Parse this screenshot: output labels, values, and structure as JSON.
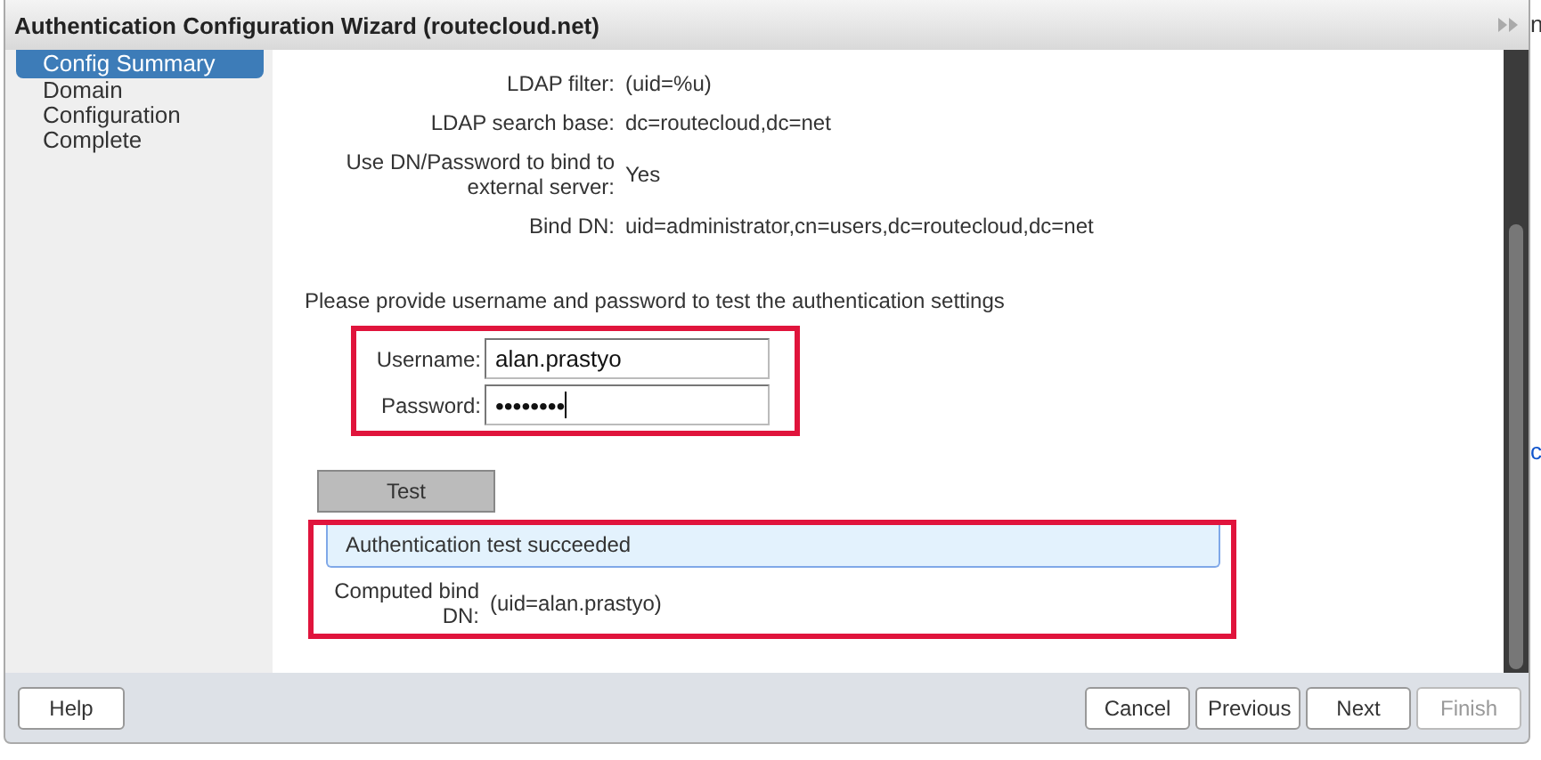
{
  "window": {
    "title": "Authentication Configuration Wizard (routecloud.net)"
  },
  "background_fragments": [
    "n",
    "c"
  ],
  "steps": [
    {
      "label": "Config Summary",
      "selected": true
    },
    {
      "label": "Domain Configuration",
      "selected": false
    },
    {
      "label": "Complete",
      "selected": false
    }
  ],
  "summary": [
    {
      "label": "LDAP filter:",
      "value": "(uid=%u)"
    },
    {
      "label": "LDAP search base:",
      "value": "dc=routecloud,dc=net"
    },
    {
      "label": "Use DN/Password to bind to external server:",
      "value": "Yes"
    },
    {
      "label": "Bind DN:",
      "value": "uid=administrator,cn=users,dc=routecloud,dc=net"
    }
  ],
  "test": {
    "instruction": "Please provide username and password to test the authentication settings",
    "username": {
      "label": "Username:",
      "value": "alan.prastyo"
    },
    "password": {
      "label": "Password:",
      "value": "••••••••"
    },
    "button": "Test",
    "result": {
      "message": "Authentication test succeeded",
      "label": "Computed bind DN:",
      "value": "(uid=alan.prastyo)"
    }
  },
  "footer": {
    "left": [
      {
        "label": "Help",
        "disabled": false
      }
    ],
    "right": [
      {
        "label": "Cancel",
        "disabled": false
      },
      {
        "label": "Previous",
        "disabled": false
      },
      {
        "label": "Next",
        "disabled": false
      },
      {
        "label": "Finish",
        "disabled": true
      }
    ]
  }
}
